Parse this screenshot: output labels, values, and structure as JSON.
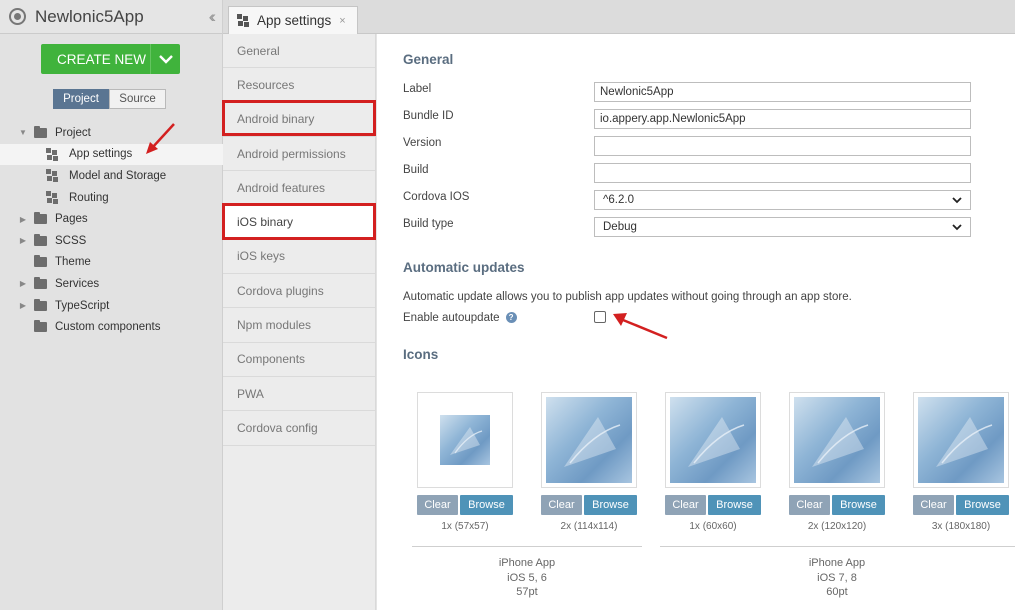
{
  "app": {
    "title": "Newlonic5App"
  },
  "create_button": {
    "label": "CREATE NEW"
  },
  "view_toggle": {
    "project": "Project",
    "source": "Source"
  },
  "tree": [
    {
      "label": "Project",
      "kind": "folder",
      "expanded": true
    },
    {
      "label": "App settings",
      "kind": "page",
      "selected": true
    },
    {
      "label": "Model and Storage",
      "kind": "page"
    },
    {
      "label": "Routing",
      "kind": "page"
    },
    {
      "label": "Pages",
      "kind": "folder"
    },
    {
      "label": "SCSS",
      "kind": "folder"
    },
    {
      "label": "Theme",
      "kind": "folder"
    },
    {
      "label": "Services",
      "kind": "folder"
    },
    {
      "label": "TypeScript",
      "kind": "folder"
    },
    {
      "label": "Custom components",
      "kind": "folder"
    }
  ],
  "tab": {
    "label": "App settings",
    "close": "×"
  },
  "settings_menu": [
    "General",
    "Resources",
    "Android binary",
    "Android permissions",
    "Android features",
    "iOS binary",
    "iOS keys",
    "Cordova plugins",
    "Npm modules",
    "Components",
    "PWA",
    "Cordova config"
  ],
  "active_menu_item": "iOS binary",
  "general": {
    "heading": "General",
    "fields": {
      "label": {
        "label": "Label",
        "value": "Newlonic5App"
      },
      "bundle_id": {
        "label": "Bundle ID",
        "value": "io.appery.app.Newlonic5App"
      },
      "version": {
        "label": "Version",
        "value": ""
      },
      "build": {
        "label": "Build",
        "value": ""
      },
      "cordova_ios": {
        "label": "Cordova IOS",
        "value": "^6.2.0"
      },
      "build_type": {
        "label": "Build type",
        "value": "Debug"
      }
    }
  },
  "updates": {
    "heading": "Automatic updates",
    "description": "Automatic update allows you to publish app updates without going through an app store.",
    "enable_label": "Enable autoupdate",
    "help": "?",
    "enabled": false
  },
  "icons": {
    "heading": "Icons",
    "items": [
      {
        "size": "1x (57x57)",
        "clear": "Clear",
        "browse": "Browse"
      },
      {
        "size": "2x (114x114)",
        "clear": "Clear",
        "browse": "Browse"
      },
      {
        "size": "1x (60x60)",
        "clear": "Clear",
        "browse": "Browse"
      },
      {
        "size": "2x (120x120)",
        "clear": "Clear",
        "browse": "Browse"
      },
      {
        "size": "3x (180x180)",
        "clear": "Clear",
        "browse": "Browse"
      }
    ],
    "groups": [
      {
        "line1": "iPhone App",
        "line2": "iOS 5, 6",
        "line3": "57pt"
      },
      {
        "line1": "iPhone App",
        "line2": "iOS 7, 8",
        "line3": "60pt"
      }
    ]
  },
  "colors": {
    "highlight": "#d32020",
    "create": "#40b33c",
    "toggle_on": "#5a7592",
    "browse": "#4f93b8",
    "clear": "#8fa3b6",
    "heading": "#5a6d80"
  }
}
